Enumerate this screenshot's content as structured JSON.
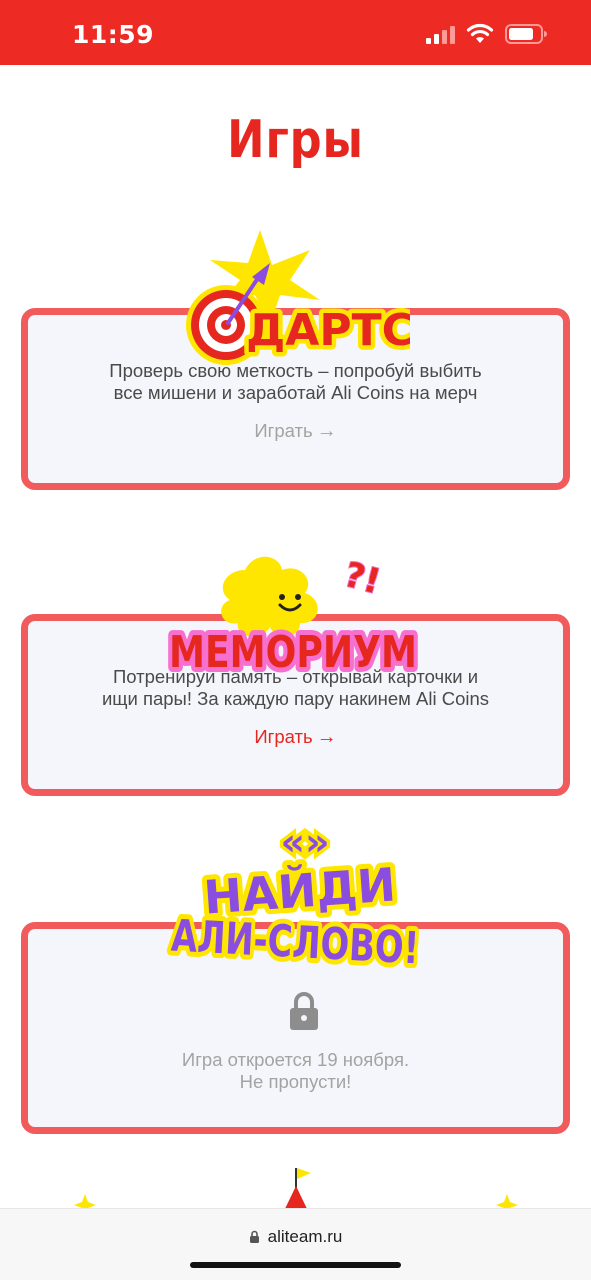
{
  "status_bar": {
    "time": "11:59",
    "signal_icon": "cellular-signal-icon",
    "wifi_icon": "wifi-icon",
    "battery_icon": "battery-icon"
  },
  "page": {
    "title": "Игры"
  },
  "games": [
    {
      "logo_text": "ДАРТС",
      "description_line1": "Проверь свою меткость – попробуй выбить",
      "description_line2": "все мишени и заработай Ali Coins на мерч",
      "play_label": "Играть",
      "play_state": "disabled",
      "icon": "dartboard-icon"
    },
    {
      "logo_text": "МЕМОРИУМ",
      "description_line1": "Потренируй память – открывай карточки и",
      "description_line2": "ищи пары! За каждую пару накинем Ali Coins",
      "play_label": "Играть",
      "play_state": "active",
      "icon": "smiley-cloud-icon"
    },
    {
      "logo_line1": "НАЙДИ",
      "logo_line2": "АЛИ-СЛОВО!",
      "locked_line1": "Игра откроется 19 ноября.",
      "locked_line2": "Не пропусти!",
      "icon": "lock-icon"
    }
  ],
  "browser": {
    "url": "aliteam.ru"
  },
  "colors": {
    "accent": "#e5271f",
    "card_border": "#f25b5b",
    "card_bg": "#f5f6fb",
    "muted": "#a3a3a3",
    "pink": "#f76fcf",
    "purple": "#8a4de0",
    "yellow": "#ffe600"
  }
}
